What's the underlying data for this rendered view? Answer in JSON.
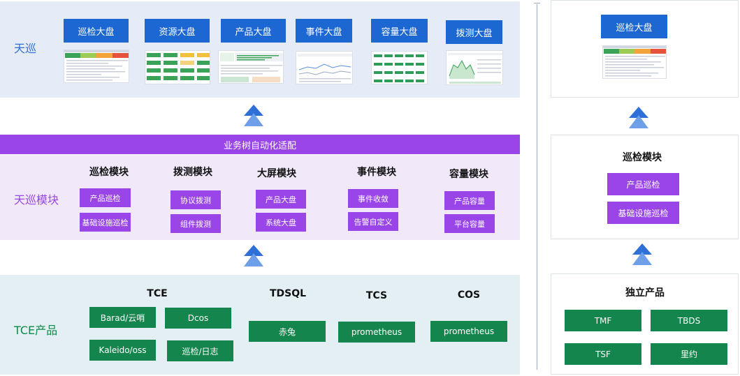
{
  "left": {
    "top_label": "天巡",
    "dashboards": [
      {
        "label": "巡检大盘",
        "thumb": "inspection-dashboard-preview"
      },
      {
        "label": "资源大盘",
        "thumb": "resource-dashboard-preview"
      },
      {
        "label": "产品大盘",
        "thumb": "product-dashboard-preview"
      },
      {
        "label": "事件大盘",
        "thumb": "event-dashboard-preview"
      },
      {
        "label": "容量大盘",
        "thumb": "capacity-dashboard-preview"
      },
      {
        "label": "拨测大盘",
        "thumb": "probe-dashboard-preview"
      }
    ],
    "adapter_bar": "业务树自动化适配",
    "module_label": "天巡模块",
    "modules": [
      {
        "title": "巡检模块",
        "items": [
          "产品巡检",
          "基础设施巡检"
        ]
      },
      {
        "title": "拨测模块",
        "items": [
          "协议拨测",
          "组件拨测"
        ]
      },
      {
        "title": "大屏模块",
        "items": [
          "产品大盘",
          "系统大盘"
        ]
      },
      {
        "title": "事件模块",
        "items": [
          "事件收敛",
          "告警自定义"
        ]
      },
      {
        "title": "容量模块",
        "items": [
          "产品容量",
          "平台容量"
        ]
      }
    ],
    "tce_label": "TCE产品",
    "tech_groups": [
      {
        "title": "TCE",
        "items": [
          "Barad/云哨",
          "Dcos",
          "Kaleido/oss",
          "巡检/日志"
        ]
      },
      {
        "title": "TDSQL",
        "items": [
          "赤兔"
        ]
      },
      {
        "title": "TCS",
        "items": [
          "prometheus"
        ]
      },
      {
        "title": "COS",
        "items": [
          "prometheus"
        ]
      }
    ]
  },
  "right": {
    "dashboard": "巡检大盘",
    "module_title": "巡检模块",
    "module_items": [
      "产品巡检",
      "基础设施巡检"
    ],
    "product_title": "独立产品",
    "products": [
      "TMF",
      "TBDS",
      "TSF",
      "里约"
    ]
  },
  "colors": {
    "blue": "#1c67d1",
    "purple": "#9945e8",
    "green": "#14854c",
    "arrow": "#2f6fd8"
  }
}
